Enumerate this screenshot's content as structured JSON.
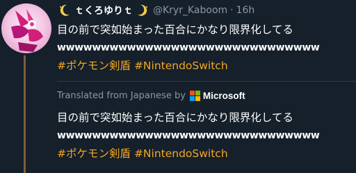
{
  "tweet": {
    "display_name": "ｔくろゆりｔ",
    "handle": "@Kryr_Kaboom",
    "separator_dot": "·",
    "time": "16h",
    "text_line1": "目の前で突如始まった百合にかなり限界化してる",
    "text_line2": "wwwwwwwwwwwwwwwwwwwwwwwwwwwwww",
    "hashtag1": "#ポケモン剣盾",
    "hashtag2": "#NintendoSwitch"
  },
  "translation": {
    "label": "Translated from Japanese by",
    "provider": "Microsoft",
    "text_line1": "目の前で突如始まった百合にかなり限界化してる",
    "text_line2": "wwwwwwwwwwwwwwwwwwwwwwwwwwwwww",
    "hashtag1": "#ポケモン剣盾",
    "hashtag2": "#NintendoSwitch"
  },
  "colors": {
    "background": "#15202b",
    "hashtag": "#f5a623",
    "muted": "#8b98a5",
    "thread_line": "#7d5e3a",
    "microsoft_red": "#f25022",
    "microsoft_green": "#7fba00",
    "microsoft_blue": "#00a4ef",
    "microsoft_yellow": "#ffb900"
  },
  "icons": {
    "name_left": "crescent-moon-icon",
    "name_right": "crescent-moon-icon",
    "provider_logo": "microsoft-logo-icon"
  }
}
